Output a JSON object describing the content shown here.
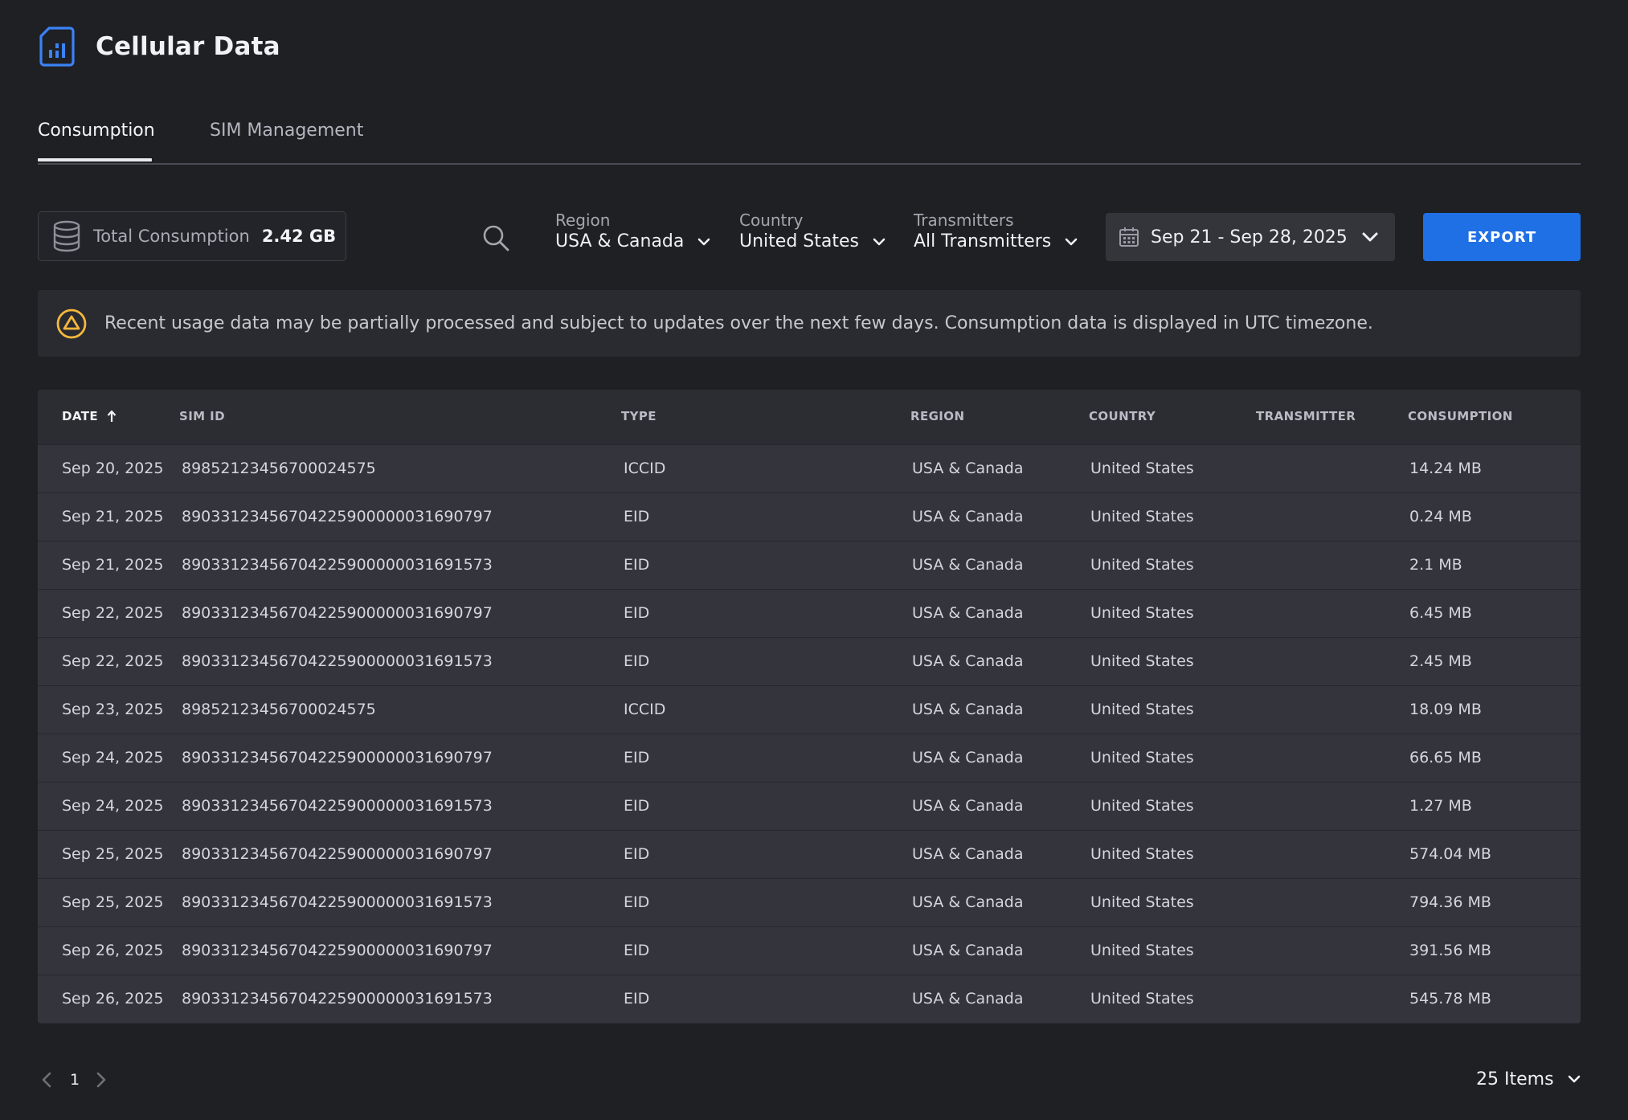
{
  "header": {
    "title": "Cellular Data",
    "icon": "sim-card-icon"
  },
  "tabs": [
    {
      "label": "Consumption",
      "active": true
    },
    {
      "label": "SIM Management",
      "active": false
    }
  ],
  "toolbar": {
    "total_label": "Total Consumption",
    "total_value": "2.42 GB",
    "region": {
      "label": "Region",
      "value": "USA & Canada"
    },
    "country": {
      "label": "Country",
      "value": "United States"
    },
    "transmitters": {
      "label": "Transmitters",
      "value": "All Transmitters"
    },
    "date_range": "Sep 21 - Sep 28, 2025",
    "export_label": "EXPORT"
  },
  "notice": {
    "text": "Recent usage data may be partially processed and subject to updates over the next few days. Consumption data is displayed in UTC timezone."
  },
  "table": {
    "columns": [
      "DATE",
      "SIM ID",
      "TYPE",
      "REGION",
      "COUNTRY",
      "TRANSMITTER",
      "CONSUMPTION"
    ],
    "sort": {
      "column": "DATE",
      "direction": "ascending"
    },
    "rows": [
      {
        "date": "Sep 20, 2025",
        "sim_id": "89852123456700024575",
        "type": "ICCID",
        "region": "USA & Canada",
        "country": "United States",
        "transmitter": "",
        "consumption": "14.24 MB"
      },
      {
        "date": "Sep 21, 2025",
        "sim_id": "89033123456704225900000031690797",
        "type": "EID",
        "region": "USA & Canada",
        "country": "United States",
        "transmitter": "",
        "consumption": "0.24 MB"
      },
      {
        "date": "Sep 21, 2025",
        "sim_id": "89033123456704225900000031691573",
        "type": "EID",
        "region": "USA & Canada",
        "country": "United States",
        "transmitter": "",
        "consumption": "2.1 MB"
      },
      {
        "date": "Sep 22, 2025",
        "sim_id": "89033123456704225900000031690797",
        "type": "EID",
        "region": "USA & Canada",
        "country": "United States",
        "transmitter": "",
        "consumption": "6.45 MB"
      },
      {
        "date": "Sep 22, 2025",
        "sim_id": "89033123456704225900000031691573",
        "type": "EID",
        "region": "USA & Canada",
        "country": "United States",
        "transmitter": "",
        "consumption": "2.45 MB"
      },
      {
        "date": "Sep 23, 2025",
        "sim_id": "89852123456700024575",
        "type": "ICCID",
        "region": "USA & Canada",
        "country": "United States",
        "transmitter": "",
        "consumption": "18.09 MB"
      },
      {
        "date": "Sep 24, 2025",
        "sim_id": "89033123456704225900000031690797",
        "type": "EID",
        "region": "USA & Canada",
        "country": "United States",
        "transmitter": "",
        "consumption": "66.65 MB"
      },
      {
        "date": "Sep 24, 2025",
        "sim_id": "89033123456704225900000031691573",
        "type": "EID",
        "region": "USA & Canada",
        "country": "United States",
        "transmitter": "",
        "consumption": "1.27 MB"
      },
      {
        "date": "Sep 25, 2025",
        "sim_id": "89033123456704225900000031690797",
        "type": "EID",
        "region": "USA & Canada",
        "country": "United States",
        "transmitter": "",
        "consumption": "574.04 MB"
      },
      {
        "date": "Sep 25, 2025",
        "sim_id": "89033123456704225900000031691573",
        "type": "EID",
        "region": "USA & Canada",
        "country": "United States",
        "transmitter": "",
        "consumption": "794.36 MB"
      },
      {
        "date": "Sep 26, 2025",
        "sim_id": "89033123456704225900000031690797",
        "type": "EID",
        "region": "USA & Canada",
        "country": "United States",
        "transmitter": "",
        "consumption": "391.56 MB"
      },
      {
        "date": "Sep 26, 2025",
        "sim_id": "89033123456704225900000031691573",
        "type": "EID",
        "region": "USA & Canada",
        "country": "United States",
        "transmitter": "",
        "consumption": "545.78 MB"
      }
    ]
  },
  "pagination": {
    "current_page": "1",
    "items_per_page": "25 Items"
  },
  "colors": {
    "background": "#1f2024",
    "accent": "#1f6fe5",
    "warning": "#f5b83d",
    "icon_blue": "#3b82f6"
  }
}
